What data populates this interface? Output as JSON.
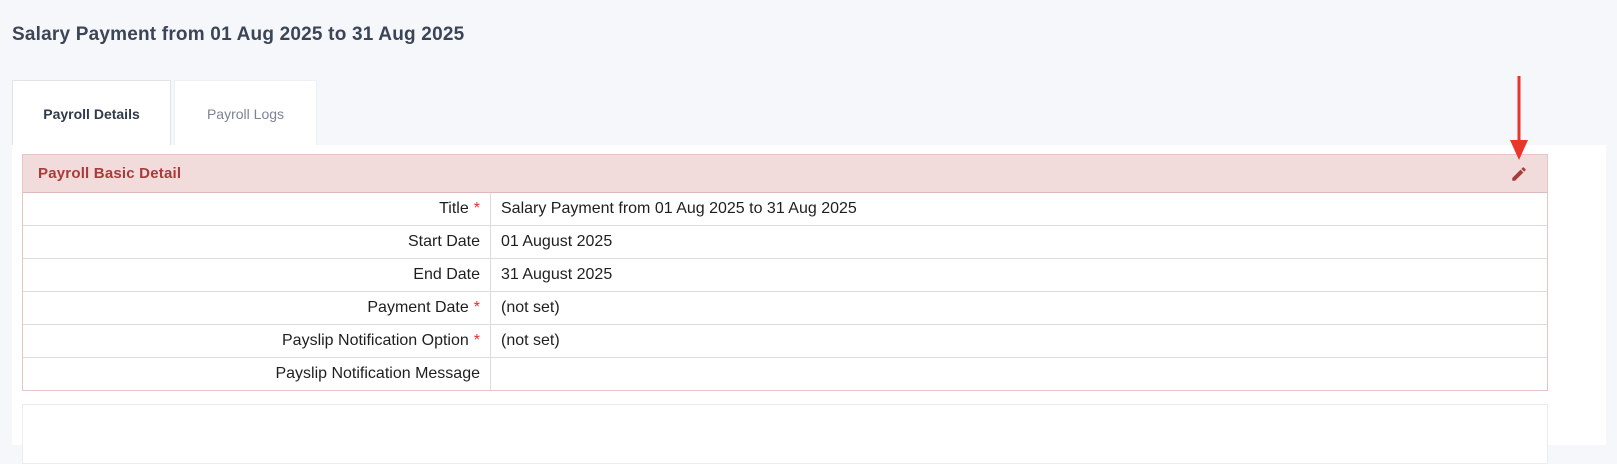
{
  "page": {
    "title": "Salary Payment from 01 Aug 2025 to 31 Aug 2025"
  },
  "tabs": [
    {
      "label": "Payroll Details",
      "active": true
    },
    {
      "label": "Payroll Logs",
      "active": false
    }
  ],
  "panel": {
    "title": "Payroll Basic Detail",
    "edit_icon": "pencil-icon",
    "header_color": "#f1dcdb",
    "title_color": "#a83c3a"
  },
  "details": [
    {
      "label": "Title",
      "required": true,
      "value": "Salary Payment from 01 Aug 2025 to 31 Aug 2025"
    },
    {
      "label": "Start Date",
      "required": false,
      "value": "01 August 2025"
    },
    {
      "label": "End Date",
      "required": false,
      "value": "31 August 2025"
    },
    {
      "label": "Payment Date",
      "required": true,
      "value": "(not set)"
    },
    {
      "label": "Payslip Notification Option",
      "required": true,
      "value": "(not set)"
    },
    {
      "label": "Payslip Notification Message",
      "required": false,
      "value": ""
    }
  ],
  "annotation": {
    "arrow_color": "#e8362a",
    "arrow_icon": "down-arrow-icon"
  }
}
